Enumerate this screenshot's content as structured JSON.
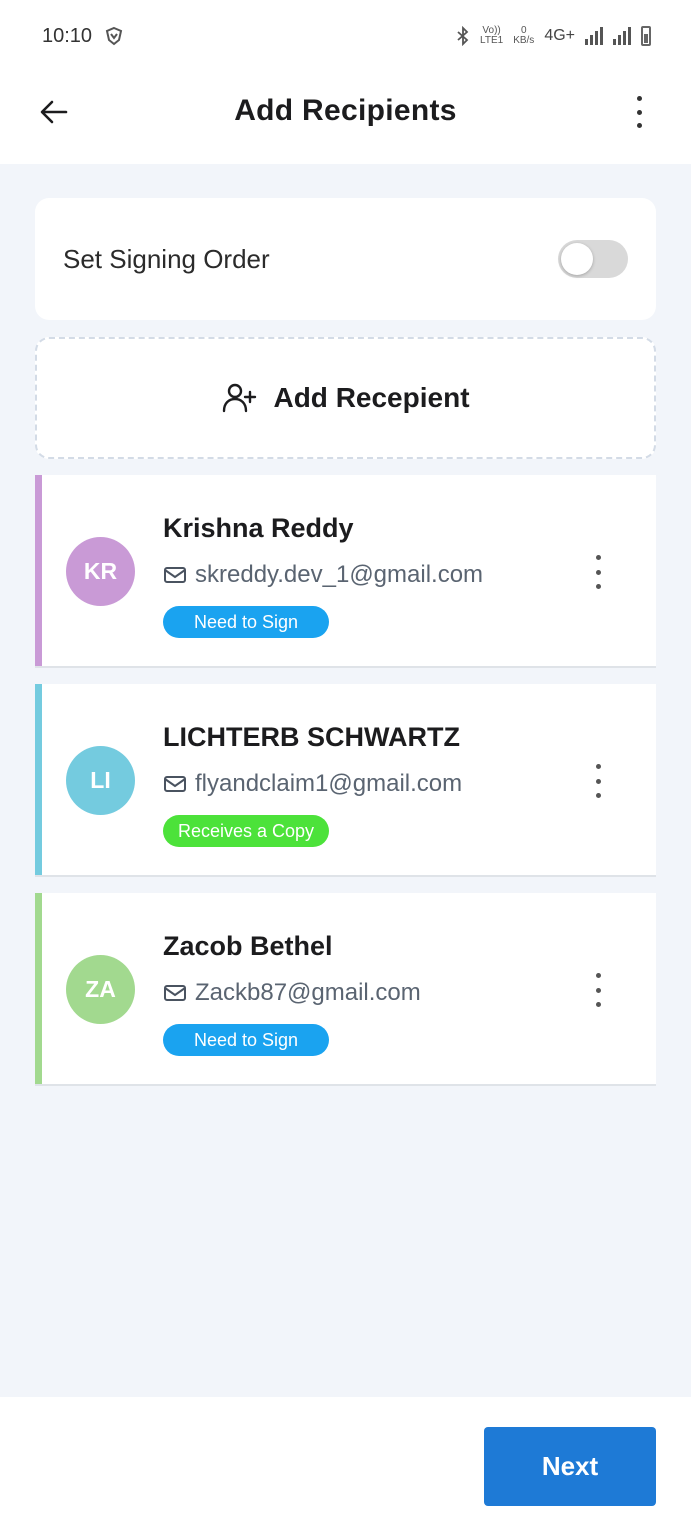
{
  "status_bar": {
    "time": "10:10",
    "volte_top": "Vo))",
    "volte_bottom": "LTE1",
    "speed_top": "0",
    "speed_bottom": "KB/s",
    "network": "4G+"
  },
  "app_bar": {
    "title": "Add Recipients"
  },
  "signing_order": {
    "label": "Set Signing Order",
    "enabled": false
  },
  "add_recipient": {
    "label": "Add Recepient"
  },
  "recipients": [
    {
      "initials": "KR",
      "name": "Krishna Reddy",
      "email": "skreddy.dev_1@gmail.com",
      "role": "Need to Sign",
      "accent_color": "#c99ad6",
      "role_color": "#1aa3f0"
    },
    {
      "initials": "LI",
      "name": "LICHTERB SCHWARTZ",
      "email": "flyandclaim1@gmail.com",
      "role": "Receives a Copy",
      "accent_color": "#74cbdf",
      "role_color": "#4ce23a"
    },
    {
      "initials": "ZA",
      "name": "Zacob Bethel",
      "email": "Zackb87@gmail.com",
      "role": "Need to Sign",
      "accent_color": "#a2d98f",
      "role_color": "#1aa3f0"
    }
  ],
  "footer": {
    "next_label": "Next",
    "button_color": "#1e7ad6"
  }
}
